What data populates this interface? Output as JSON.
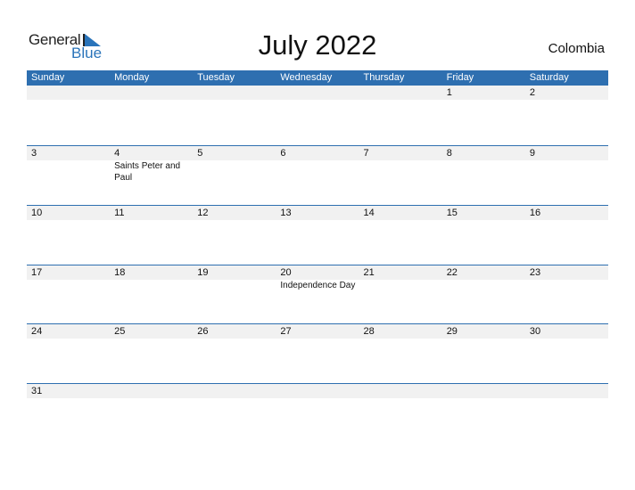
{
  "logo": {
    "line1": "General",
    "line2": "Blue"
  },
  "title": "July 2022",
  "country": "Colombia",
  "colors": {
    "header": "#2e6fb0",
    "strip": "#f1f1f1"
  },
  "weekdays": [
    "Sunday",
    "Monday",
    "Tuesday",
    "Wednesday",
    "Thursday",
    "Friday",
    "Saturday"
  ],
  "weeks": [
    [
      {
        "d": ""
      },
      {
        "d": ""
      },
      {
        "d": ""
      },
      {
        "d": ""
      },
      {
        "d": ""
      },
      {
        "d": "1"
      },
      {
        "d": "2"
      }
    ],
    [
      {
        "d": "3"
      },
      {
        "d": "4",
        "ev": "Saints Peter and Paul"
      },
      {
        "d": "5"
      },
      {
        "d": "6"
      },
      {
        "d": "7"
      },
      {
        "d": "8"
      },
      {
        "d": "9"
      }
    ],
    [
      {
        "d": "10"
      },
      {
        "d": "11"
      },
      {
        "d": "12"
      },
      {
        "d": "13"
      },
      {
        "d": "14"
      },
      {
        "d": "15"
      },
      {
        "d": "16"
      }
    ],
    [
      {
        "d": "17"
      },
      {
        "d": "18"
      },
      {
        "d": "19"
      },
      {
        "d": "20",
        "ev": "Independence Day"
      },
      {
        "d": "21"
      },
      {
        "d": "22"
      },
      {
        "d": "23"
      }
    ],
    [
      {
        "d": "24"
      },
      {
        "d": "25"
      },
      {
        "d": "26"
      },
      {
        "d": "27"
      },
      {
        "d": "28"
      },
      {
        "d": "29"
      },
      {
        "d": "30"
      }
    ],
    [
      {
        "d": "31"
      },
      {
        "d": ""
      },
      {
        "d": ""
      },
      {
        "d": ""
      },
      {
        "d": ""
      },
      {
        "d": ""
      },
      {
        "d": ""
      }
    ]
  ]
}
